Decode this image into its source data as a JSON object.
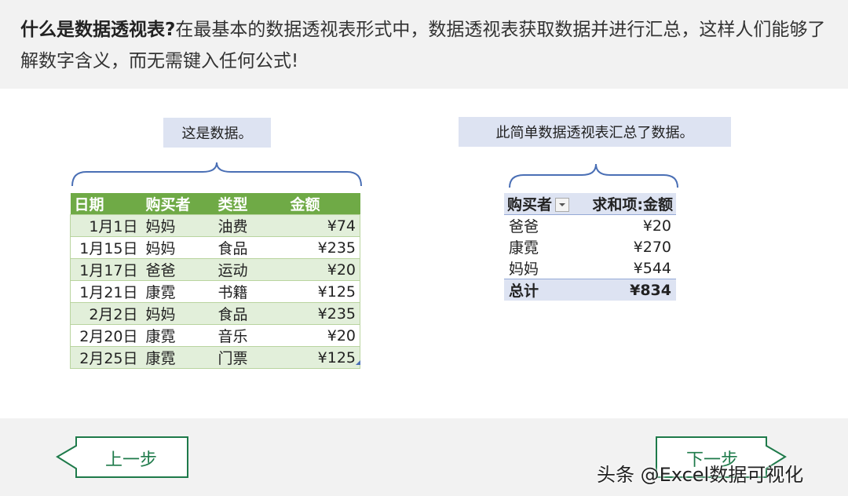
{
  "intro": {
    "title": "什么是数据透视表?",
    "text": "在最基本的数据透视表形式中，数据透视表获取数据并进行汇总，这样人们能够了解数字含义，而无需键入任何公式!"
  },
  "left_callout": "这是数据。",
  "right_callout": "此简单数据透视表汇总了数据。",
  "source_table": {
    "headers": [
      "日期",
      "购买者",
      "类型",
      "金额"
    ],
    "rows": [
      [
        "1月1日",
        "妈妈",
        "油费",
        "¥74"
      ],
      [
        "1月15日",
        "妈妈",
        "食品",
        "¥235"
      ],
      [
        "1月17日",
        "爸爸",
        "运动",
        "¥20"
      ],
      [
        "1月21日",
        "康霓",
        "书籍",
        "¥125"
      ],
      [
        "2月2日",
        "妈妈",
        "食品",
        "¥235"
      ],
      [
        "2月20日",
        "康霓",
        "音乐",
        "¥20"
      ],
      [
        "2月25日",
        "康霓",
        "门票",
        "¥125"
      ]
    ]
  },
  "pivot_table": {
    "headers": [
      "购买者",
      "求和项:金额"
    ],
    "rows": [
      [
        "爸爸",
        "¥20"
      ],
      [
        "康霓",
        "¥270"
      ],
      [
        "妈妈",
        "¥544"
      ]
    ],
    "total": [
      "总计",
      "¥834"
    ]
  },
  "nav": {
    "prev_label": "上一步",
    "next_label": "下一步"
  },
  "watermark": "头条 @Excel数据可视化",
  "colors": {
    "table_header": "#6faa46",
    "table_band": "#e2efda",
    "callout_bg": "#dde3f2",
    "brace": "#4a6fb5",
    "nav_green": "#1e7a4a"
  }
}
